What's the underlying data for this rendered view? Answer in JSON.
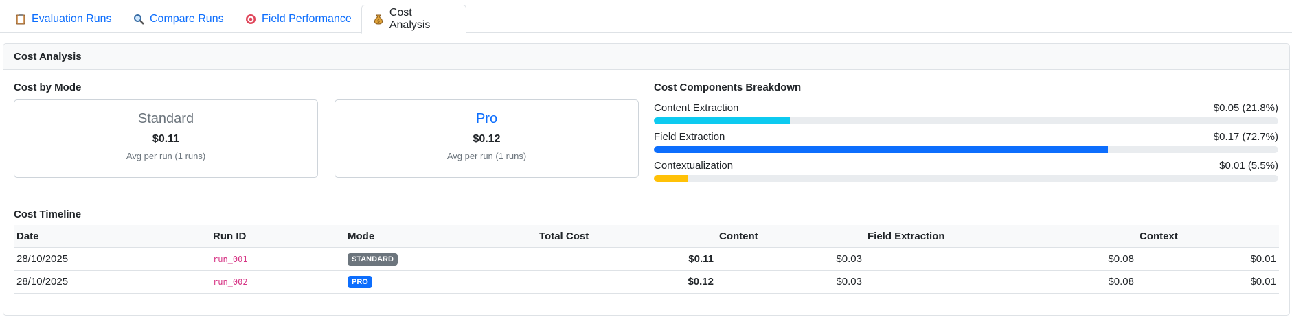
{
  "tabs": [
    {
      "label": "Evaluation Runs",
      "icon": "clipboard-icon"
    },
    {
      "label": "Compare Runs",
      "icon": "magnifier-icon"
    },
    {
      "label": "Field Performance",
      "icon": "target-icon"
    },
    {
      "label": "Cost Analysis",
      "icon": "money-bag-icon",
      "active": true
    }
  ],
  "card": {
    "title": "Cost Analysis"
  },
  "cost_by_mode": {
    "title": "Cost by Mode",
    "modes": [
      {
        "name": "Standard",
        "cost": "$0.11",
        "subtitle": "Avg per run (1 runs)",
        "color": "#6c757d"
      },
      {
        "name": "Pro",
        "cost": "$0.12",
        "subtitle": "Avg per run (1 runs)",
        "color": "#0d6efd"
      }
    ]
  },
  "components": {
    "title": "Cost Components Breakdown",
    "items": [
      {
        "label": "Content Extraction",
        "value": "$0.05 (21.8%)",
        "percent": 21.8,
        "color": "#0dcaf0"
      },
      {
        "label": "Field Extraction",
        "value": "$0.17 (72.7%)",
        "percent": 72.7,
        "color": "#0d6efd"
      },
      {
        "label": "Contextualization",
        "value": "$0.01 (5.5%)",
        "percent": 5.5,
        "color": "#ffc107"
      }
    ]
  },
  "timeline": {
    "title": "Cost Timeline",
    "headers": [
      "Date",
      "Run ID",
      "Mode",
      "Total Cost",
      "Content",
      "Field Extraction",
      "Context"
    ],
    "rows": [
      {
        "date": "28/10/2025",
        "run_id": "run_001",
        "mode": "STANDARD",
        "mode_color": "#6c757d",
        "total": "$0.11",
        "content": "$0.03",
        "field": "$0.08",
        "context": "$0.01"
      },
      {
        "date": "28/10/2025",
        "run_id": "run_002",
        "mode": "PRO",
        "mode_color": "#0d6efd",
        "total": "$0.12",
        "content": "$0.03",
        "field": "$0.08",
        "context": "$0.01"
      }
    ]
  }
}
